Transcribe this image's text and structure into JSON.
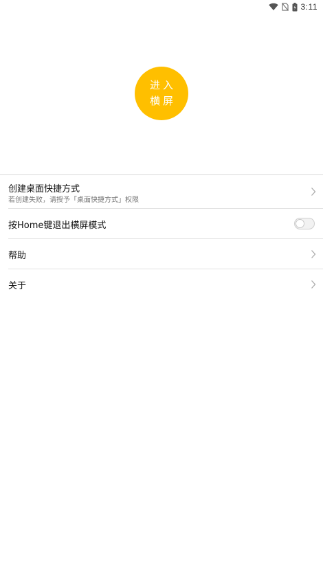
{
  "status_bar": {
    "time": "3:11",
    "icons": [
      "wifi-icon",
      "no-sim-icon",
      "battery-icon"
    ]
  },
  "enter_button": {
    "line1": "进入",
    "line2": "横屏",
    "color": "#FFBF00"
  },
  "settings": {
    "shortcut": {
      "title": "创建桌面快捷方式",
      "subtitle": "若创建失败，请授予「桌面快捷方式」权限"
    },
    "home_exit": {
      "title": "按Home键退出横屏模式",
      "enabled": false
    },
    "help": {
      "title": "帮助"
    },
    "about": {
      "title": "关于"
    }
  }
}
